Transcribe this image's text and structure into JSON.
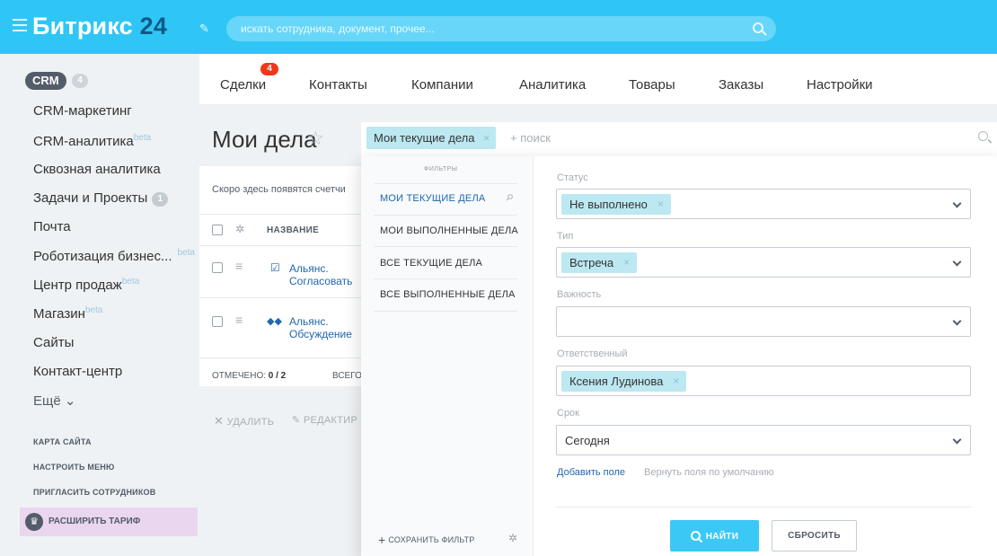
{
  "header": {
    "logo_main": "Битрикс",
    "logo_num": "24",
    "search_placeholder": "искать сотрудника, документ, прочее..."
  },
  "sidebar": {
    "crm_label": "CRM",
    "crm_count": "4",
    "items": [
      {
        "label": "CRM-маркетинг"
      },
      {
        "label": "CRM-аналитика",
        "sup": "beta"
      },
      {
        "label": "Сквозная аналитика"
      },
      {
        "label": "Задачи и Проекты",
        "count": "1"
      },
      {
        "label": "Почта"
      },
      {
        "label": "Роботизация бизнес...",
        "sup": "beta"
      },
      {
        "label": "Центр продаж",
        "sup": "beta"
      },
      {
        "label": "Магазин",
        "sup": "beta"
      },
      {
        "label": "Сайты"
      },
      {
        "label": "Контакт-центр"
      },
      {
        "label": "Ещё ⌄"
      }
    ],
    "links": [
      "КАРТА САЙТА",
      "НАСТРОИТЬ МЕНЮ",
      "ПРИГЛАСИТЬ СОТРУДНИКОВ"
    ],
    "upgrade_label": "РАСШИРИТЬ ТАРИФ"
  },
  "tabs": [
    {
      "label": "Сделки",
      "badge": "4"
    },
    {
      "label": "Контакты"
    },
    {
      "label": "Компании"
    },
    {
      "label": "Аналитика"
    },
    {
      "label": "Товары"
    },
    {
      "label": "Заказы"
    },
    {
      "label": "Настройки"
    }
  ],
  "page": {
    "title": "Мои дела",
    "active_filter": "Мои текущие дела",
    "search_placeholder": "+ поиск",
    "counter_text": "Скоро здесь появятся счетчи",
    "column_name": "НАЗВАНИЕ",
    "rows": [
      {
        "line1": "Альянс.",
        "line2": "Согласовать"
      },
      {
        "line1": "Альянс.",
        "line2": "Обсуждение"
      }
    ],
    "selected_label": "ОТМЕЧЕНО:",
    "selected_value": "0 / 2",
    "total_label": "ВСЕГО",
    "delete_label": "УДАЛИТЬ",
    "edit_label": "РЕДАКТИР"
  },
  "filter_popup": {
    "heading": "ФИЛЬТРЫ",
    "presets": [
      "МОИ ТЕКУЩИЕ ДЕЛА",
      "МОИ ВЫПОЛНЕННЫЕ ДЕЛА",
      "ВСЕ ТЕКУЩИЕ ДЕЛА",
      "ВСЕ ВЫПОЛНЕННЫЕ ДЕЛА"
    ],
    "save_filter": "СОХРАНИТЬ ФИЛЬТР",
    "fields": {
      "status_label": "Статус",
      "status_value": "Не выполнено",
      "type_label": "Тип",
      "type_value": "Встреча",
      "importance_label": "Важность",
      "responsible_label": "Ответственный",
      "responsible_value": "Ксения Лудинова",
      "deadline_label": "Срок",
      "deadline_value": "Сегодня"
    },
    "add_field": "Добавить поле",
    "reset_fields": "Вернуть поля по умолчанию",
    "find_button": "НАЙТИ",
    "reset_button": "СБРОСИТЬ"
  },
  "colors": {
    "header_bg": "#2fc6f6",
    "chip_bg": "#bce8f1",
    "link_blue": "#2067b0",
    "find_button": "#3bc8f5",
    "badge_red": "#f1361b"
  }
}
